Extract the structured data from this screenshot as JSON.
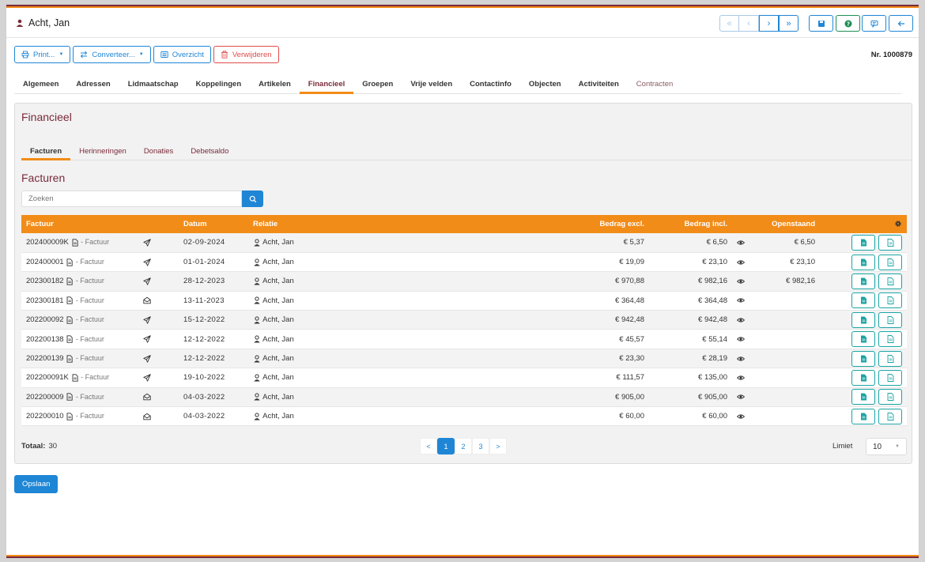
{
  "header": {
    "title": "Acht, Jan"
  },
  "toolbar": {
    "print": "Print...",
    "convert": "Converteer...",
    "overview": "Overzicht",
    "delete": "Verwijderen",
    "nr": "Nr. 1000879"
  },
  "main_tabs": [
    "Algemeen",
    "Adressen",
    "Lidmaatschap",
    "Koppelingen",
    "Artikelen",
    "Financieel",
    "Groepen",
    "Vrije velden",
    "Contactinfo",
    "Objecten",
    "Activiteiten",
    "Contracten"
  ],
  "panel": {
    "title": "Financieel",
    "subtabs": [
      "Facturen",
      "Herinneringen",
      "Donaties",
      "Debetsaldo"
    ],
    "section_title": "Facturen",
    "search_placeholder": "Zoeken"
  },
  "table": {
    "headers": [
      "Factuur",
      "Datum",
      "Relatie",
      "Bedrag excl.",
      "Bedrag incl.",
      "Openstaand"
    ],
    "type_label": "- Factuur",
    "rows": [
      {
        "nr": "202400009K",
        "status": "sent",
        "datum": "02-09-2024",
        "relatie": "Acht, Jan",
        "excl": "€ 5,37",
        "incl": "€ 6,50",
        "open": "€ 6,50"
      },
      {
        "nr": "202400001",
        "status": "sent",
        "datum": "01-01-2024",
        "relatie": "Acht, Jan",
        "excl": "€ 19,09",
        "incl": "€ 23,10",
        "open": "€ 23,10"
      },
      {
        "nr": "202300182",
        "status": "sent",
        "datum": "28-12-2023",
        "relatie": "Acht, Jan",
        "excl": "€ 970,88",
        "incl": "€ 982,16",
        "open": "€ 982,16"
      },
      {
        "nr": "202300181",
        "status": "opened",
        "datum": "13-11-2023",
        "relatie": "Acht, Jan",
        "excl": "€ 364,48",
        "incl": "€ 364,48",
        "open": ""
      },
      {
        "nr": "202200092",
        "status": "sent",
        "datum": "15-12-2022",
        "relatie": "Acht, Jan",
        "excl": "€ 942,48",
        "incl": "€ 942,48",
        "open": ""
      },
      {
        "nr": "202200138",
        "status": "sent",
        "datum": "12-12-2022",
        "relatie": "Acht, Jan",
        "excl": "€ 45,57",
        "incl": "€ 55,14",
        "open": ""
      },
      {
        "nr": "202200139",
        "status": "sent",
        "datum": "12-12-2022",
        "relatie": "Acht, Jan",
        "excl": "€ 23,30",
        "incl": "€ 28,19",
        "open": ""
      },
      {
        "nr": "202200091K",
        "status": "sent",
        "datum": "19-10-2022",
        "relatie": "Acht, Jan",
        "excl": "€ 111,57",
        "incl": "€ 135,00",
        "open": ""
      },
      {
        "nr": "202200009",
        "status": "opened",
        "datum": "04-03-2022",
        "relatie": "Acht, Jan",
        "excl": "€ 905,00",
        "incl": "€ 905,00",
        "open": ""
      },
      {
        "nr": "202200010",
        "status": "opened",
        "datum": "04-03-2022",
        "relatie": "Acht, Jan",
        "excl": "€ 60,00",
        "incl": "€ 60,00",
        "open": ""
      }
    ]
  },
  "footer": {
    "total_label": "Totaal:",
    "total_value": "30",
    "pages": [
      "1",
      "2",
      "3"
    ],
    "prev": "<",
    "next": ">",
    "limit_label": "Limiet",
    "limit_value": "10",
    "save": "Opslaan"
  },
  "colors": {
    "accent": "#f28c18",
    "primary": "#1f86d6",
    "brand": "#7a2a3a",
    "teal": "#1aa3a3"
  }
}
